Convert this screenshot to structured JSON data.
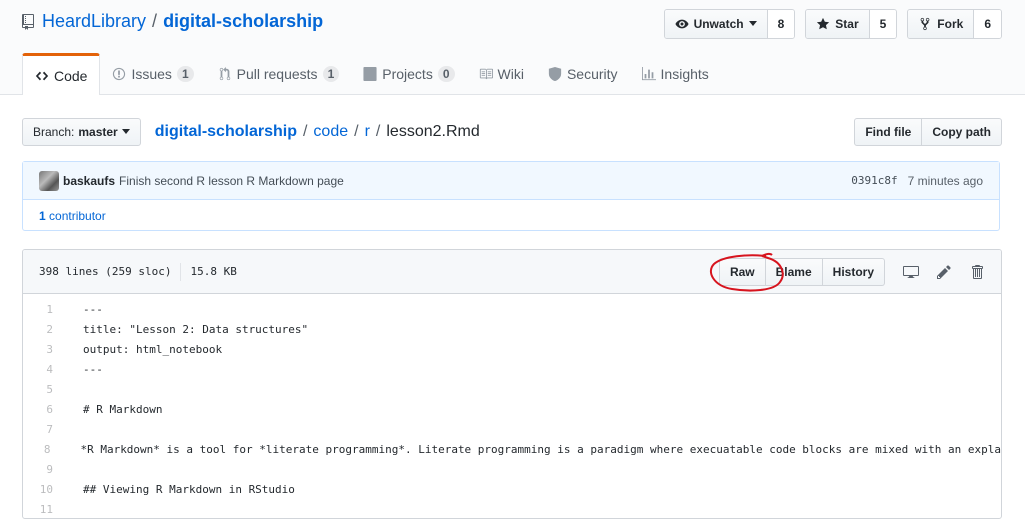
{
  "repo": {
    "owner": "HeardLibrary",
    "separator": "/",
    "name": "digital-scholarship"
  },
  "repo_actions": [
    {
      "label": "Unwatch",
      "count": "8",
      "icon": "eye-icon",
      "dropdown": true
    },
    {
      "label": "Star",
      "count": "5",
      "icon": "star-icon"
    },
    {
      "label": "Fork",
      "count": "6",
      "icon": "fork-icon"
    }
  ],
  "tabs": [
    {
      "label": "Code",
      "icon": "code-icon",
      "selected": true
    },
    {
      "label": "Issues",
      "count": "1",
      "icon": "issue-icon"
    },
    {
      "label": "Pull requests",
      "count": "1",
      "icon": "pull-request-icon"
    },
    {
      "label": "Projects",
      "count": "0",
      "icon": "project-icon"
    },
    {
      "label": "Wiki",
      "icon": "book-icon"
    },
    {
      "label": "Security",
      "icon": "shield-icon"
    },
    {
      "label": "Insights",
      "icon": "graph-icon"
    }
  ],
  "branch": {
    "prefix": "Branch:",
    "name": "master"
  },
  "breadcrumb": {
    "root": "digital-scholarship",
    "parts": [
      "code",
      "r"
    ],
    "file": "lesson2.Rmd",
    "sep": "/"
  },
  "path_actions": {
    "find_file": "Find file",
    "copy_path": "Copy path"
  },
  "commit": {
    "author": "baskaufs",
    "message": "Finish second R lesson R Markdown page",
    "sha": "0391c8f",
    "time": "7 minutes ago",
    "contributors": "1 contributor",
    "contributors_count": "1",
    "contributors_label": "contributor"
  },
  "file": {
    "lines_info": "398 lines (259 sloc)",
    "size": "15.8 KB",
    "raw_label": "Raw",
    "blame_label": "Blame",
    "history_label": "History"
  },
  "code_lines": [
    {
      "n": "1",
      "text": "---"
    },
    {
      "n": "2",
      "text": "title: \"Lesson 2: Data structures\""
    },
    {
      "n": "3",
      "text": "output: html_notebook"
    },
    {
      "n": "4",
      "text": "---"
    },
    {
      "n": "5",
      "text": ""
    },
    {
      "n": "6",
      "text": "# R Markdown"
    },
    {
      "n": "7",
      "text": ""
    },
    {
      "n": "8",
      "text": "*R Markdown* is a tool for *literate programming*. Literate programming is a paradigm where execuatable code blocks are mixed with an expla"
    },
    {
      "n": "9",
      "text": ""
    },
    {
      "n": "10",
      "text": "## Viewing R Markdown in RStudio"
    },
    {
      "n": "11",
      "text": ""
    }
  ],
  "colors": {
    "link": "#0366d6",
    "annotation": "#d7141e",
    "tab_accent": "#e36209"
  }
}
